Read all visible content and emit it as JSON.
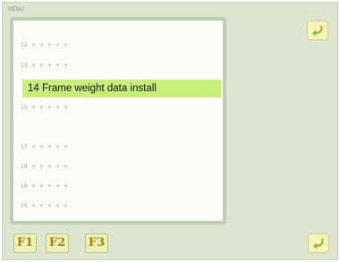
{
  "window": {
    "corner_label": "MENU"
  },
  "list": {
    "items": [
      {
        "code": "12",
        "dots": "+ + + + +"
      },
      {
        "code": "13",
        "dots": "+ + + + +"
      },
      {
        "label": "14 Frame weight data install"
      },
      {
        "code": "15",
        "dots": "+ + + + +"
      },
      {
        "code": "17",
        "dots": "+ + + + +"
      },
      {
        "code": "18",
        "dots": "+ + + + +"
      },
      {
        "code": "19",
        "dots": "+ + + + +"
      },
      {
        "code": "20",
        "dots": "+ + + + +"
      }
    ],
    "selected_index": 2
  },
  "buttons": {
    "top_right": {
      "icon": "return-arrow-icon"
    },
    "bottom_right": {
      "icon": "return-arrow-icon"
    }
  },
  "function_keys": [
    {
      "label": "F1"
    },
    {
      "label": "F2"
    },
    {
      "label": "F3"
    }
  ],
  "colors": {
    "background": "#dde4d0",
    "panel": "#fbfcf6",
    "selected": "#c7ef7a",
    "button": "#f7f4b8"
  }
}
